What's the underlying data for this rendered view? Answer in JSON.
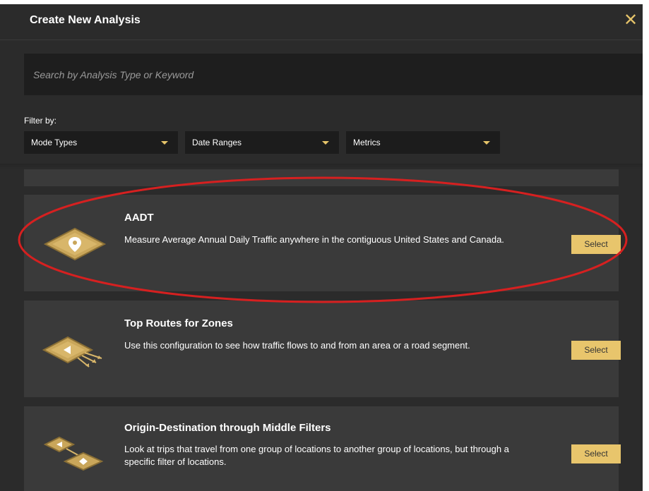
{
  "modal": {
    "title": "Create New Analysis",
    "close_icon": "close-icon"
  },
  "search": {
    "placeholder": "Search by Analysis Type or Keyword",
    "value": ""
  },
  "filters": {
    "label": "Filter by:",
    "dropdowns": [
      {
        "label": "Mode Types"
      },
      {
        "label": "Date Ranges"
      },
      {
        "label": "Metrics"
      }
    ]
  },
  "analyses": [
    {
      "title": "AADT",
      "description": "Measure Average Annual Daily Traffic anywhere in the contiguous United States and Canada.",
      "button": "Select",
      "icon": "location-pin-diamond-icon"
    },
    {
      "title": "Top Routes for Zones",
      "description": "Use this configuration to see how traffic flows to and from an area or a road segment.",
      "button": "Select",
      "icon": "zone-routes-icon"
    },
    {
      "title": "Origin-Destination through Middle Filters",
      "description": "Look at trips that travel from one group of locations to another group of locations, but through a specific filter of locations.",
      "button": "Select",
      "icon": "origin-destination-icon"
    }
  ],
  "colors": {
    "background": "#2b2b2b",
    "card": "#3a3a3a",
    "accent": "#e8c56c",
    "highlight": "#d62020"
  }
}
